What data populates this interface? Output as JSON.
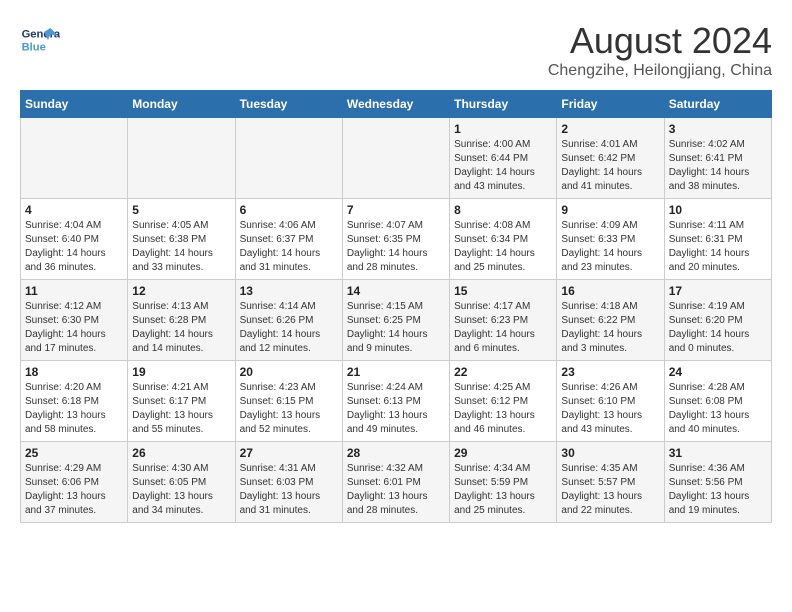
{
  "logo": {
    "line1": "General",
    "line2": "Blue"
  },
  "title": "August 2024",
  "subtitle": "Chengzihe, Heilongjiang, China",
  "days_of_week": [
    "Sunday",
    "Monday",
    "Tuesday",
    "Wednesday",
    "Thursday",
    "Friday",
    "Saturday"
  ],
  "weeks": [
    [
      {
        "day": "",
        "info": ""
      },
      {
        "day": "",
        "info": ""
      },
      {
        "day": "",
        "info": ""
      },
      {
        "day": "",
        "info": ""
      },
      {
        "day": "1",
        "info": "Sunrise: 4:00 AM\nSunset: 6:44 PM\nDaylight: 14 hours\nand 43 minutes."
      },
      {
        "day": "2",
        "info": "Sunrise: 4:01 AM\nSunset: 6:42 PM\nDaylight: 14 hours\nand 41 minutes."
      },
      {
        "day": "3",
        "info": "Sunrise: 4:02 AM\nSunset: 6:41 PM\nDaylight: 14 hours\nand 38 minutes."
      }
    ],
    [
      {
        "day": "4",
        "info": "Sunrise: 4:04 AM\nSunset: 6:40 PM\nDaylight: 14 hours\nand 36 minutes."
      },
      {
        "day": "5",
        "info": "Sunrise: 4:05 AM\nSunset: 6:38 PM\nDaylight: 14 hours\nand 33 minutes."
      },
      {
        "day": "6",
        "info": "Sunrise: 4:06 AM\nSunset: 6:37 PM\nDaylight: 14 hours\nand 31 minutes."
      },
      {
        "day": "7",
        "info": "Sunrise: 4:07 AM\nSunset: 6:35 PM\nDaylight: 14 hours\nand 28 minutes."
      },
      {
        "day": "8",
        "info": "Sunrise: 4:08 AM\nSunset: 6:34 PM\nDaylight: 14 hours\nand 25 minutes."
      },
      {
        "day": "9",
        "info": "Sunrise: 4:09 AM\nSunset: 6:33 PM\nDaylight: 14 hours\nand 23 minutes."
      },
      {
        "day": "10",
        "info": "Sunrise: 4:11 AM\nSunset: 6:31 PM\nDaylight: 14 hours\nand 20 minutes."
      }
    ],
    [
      {
        "day": "11",
        "info": "Sunrise: 4:12 AM\nSunset: 6:30 PM\nDaylight: 14 hours\nand 17 minutes."
      },
      {
        "day": "12",
        "info": "Sunrise: 4:13 AM\nSunset: 6:28 PM\nDaylight: 14 hours\nand 14 minutes."
      },
      {
        "day": "13",
        "info": "Sunrise: 4:14 AM\nSunset: 6:26 PM\nDaylight: 14 hours\nand 12 minutes."
      },
      {
        "day": "14",
        "info": "Sunrise: 4:15 AM\nSunset: 6:25 PM\nDaylight: 14 hours\nand 9 minutes."
      },
      {
        "day": "15",
        "info": "Sunrise: 4:17 AM\nSunset: 6:23 PM\nDaylight: 14 hours\nand 6 minutes."
      },
      {
        "day": "16",
        "info": "Sunrise: 4:18 AM\nSunset: 6:22 PM\nDaylight: 14 hours\nand 3 minutes."
      },
      {
        "day": "17",
        "info": "Sunrise: 4:19 AM\nSunset: 6:20 PM\nDaylight: 14 hours\nand 0 minutes."
      }
    ],
    [
      {
        "day": "18",
        "info": "Sunrise: 4:20 AM\nSunset: 6:18 PM\nDaylight: 13 hours\nand 58 minutes."
      },
      {
        "day": "19",
        "info": "Sunrise: 4:21 AM\nSunset: 6:17 PM\nDaylight: 13 hours\nand 55 minutes."
      },
      {
        "day": "20",
        "info": "Sunrise: 4:23 AM\nSunset: 6:15 PM\nDaylight: 13 hours\nand 52 minutes."
      },
      {
        "day": "21",
        "info": "Sunrise: 4:24 AM\nSunset: 6:13 PM\nDaylight: 13 hours\nand 49 minutes."
      },
      {
        "day": "22",
        "info": "Sunrise: 4:25 AM\nSunset: 6:12 PM\nDaylight: 13 hours\nand 46 minutes."
      },
      {
        "day": "23",
        "info": "Sunrise: 4:26 AM\nSunset: 6:10 PM\nDaylight: 13 hours\nand 43 minutes."
      },
      {
        "day": "24",
        "info": "Sunrise: 4:28 AM\nSunset: 6:08 PM\nDaylight: 13 hours\nand 40 minutes."
      }
    ],
    [
      {
        "day": "25",
        "info": "Sunrise: 4:29 AM\nSunset: 6:06 PM\nDaylight: 13 hours\nand 37 minutes."
      },
      {
        "day": "26",
        "info": "Sunrise: 4:30 AM\nSunset: 6:05 PM\nDaylight: 13 hours\nand 34 minutes."
      },
      {
        "day": "27",
        "info": "Sunrise: 4:31 AM\nSunset: 6:03 PM\nDaylight: 13 hours\nand 31 minutes."
      },
      {
        "day": "28",
        "info": "Sunrise: 4:32 AM\nSunset: 6:01 PM\nDaylight: 13 hours\nand 28 minutes."
      },
      {
        "day": "29",
        "info": "Sunrise: 4:34 AM\nSunset: 5:59 PM\nDaylight: 13 hours\nand 25 minutes."
      },
      {
        "day": "30",
        "info": "Sunrise: 4:35 AM\nSunset: 5:57 PM\nDaylight: 13 hours\nand 22 minutes."
      },
      {
        "day": "31",
        "info": "Sunrise: 4:36 AM\nSunset: 5:56 PM\nDaylight: 13 hours\nand 19 minutes."
      }
    ]
  ]
}
